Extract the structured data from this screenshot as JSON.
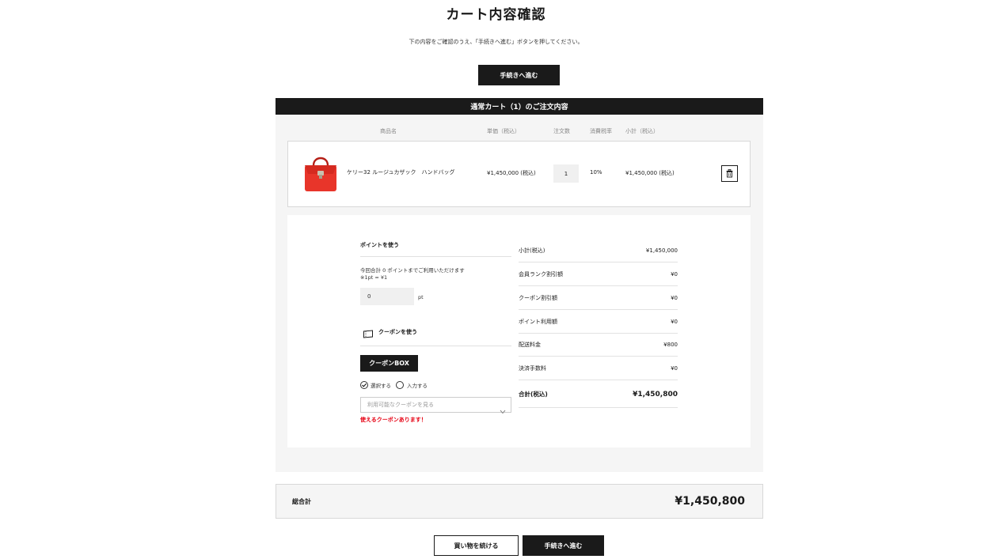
{
  "header": {
    "title": "カート内容確認",
    "instruction": "下の内容をご確認のうえ、「手続きへ進む」ボタンを押してください。",
    "proceed_label": "手続きへ進む"
  },
  "cart": {
    "section_title": "通常カート（1）のご注文内容",
    "columns": {
      "product": "商品名",
      "unit_price": "単価（税込）",
      "quantity": "注文数",
      "tax_rate": "消費税率",
      "subtotal": "小計（税込）"
    },
    "items": [
      {
        "name": "ケリー32 ルージュカザック　ハンドバッグ",
        "unit_price": "¥1,450,000 (税込)",
        "quantity": "1",
        "tax_rate": "10%",
        "subtotal": "¥1,450,000 (税込)",
        "image_icon": "red-handbag-image"
      }
    ]
  },
  "points": {
    "title": "ポイントを使う",
    "available_note": "今回合計 0 ポイントまでご利用いただけます",
    "rate_note": "※1pt = ¥1",
    "input_value": "0",
    "unit": "pt"
  },
  "coupon": {
    "title": "クーポンを使う",
    "box_label": "クーポンBOX",
    "option_select": "選択する",
    "option_input": "入力する",
    "select_placeholder": "利用可能なクーポンを見る",
    "notice": "使えるクーポンあります！"
  },
  "summary": {
    "rows": [
      {
        "label": "小計(税込)",
        "value": "¥1,450,000"
      },
      {
        "label": "会員ランク割引額",
        "value": "¥0"
      },
      {
        "label": "クーポン割引額",
        "value": "¥0"
      },
      {
        "label": "ポイント利用額",
        "value": "¥0"
      },
      {
        "label": "配送料金",
        "value": "¥800"
      },
      {
        "label": "決済手数料",
        "value": "¥0"
      }
    ],
    "total_label": "合計(税込)",
    "total_value": "¥1,450,800"
  },
  "grand_total": {
    "label": "総合計",
    "value": "¥1,450,800"
  },
  "footer": {
    "continue_label": "買い物を続ける",
    "proceed_label": "手続きへ進む"
  },
  "colors": {
    "dark": "#1a1a1a",
    "panel": "#f5f5f5",
    "notice": "#e60012",
    "handbag": "#e8352a"
  }
}
